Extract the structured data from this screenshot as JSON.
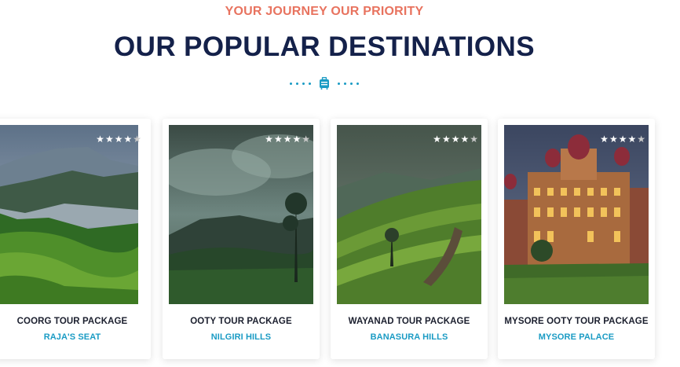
{
  "header": {
    "eyebrow": "YOUR JOURNEY OUR PRIORITY",
    "title": "OUR POPULAR DESTINATIONS",
    "divider_icon": "luggage-icon"
  },
  "colors": {
    "accent_orange": "#e8735f",
    "heading_navy": "#14214a",
    "accent_blue": "#1a9bc4"
  },
  "cards": [
    {
      "package": "COORG TOUR PACKAGE",
      "place": "RAJA'S SEAT",
      "rating": 4,
      "rating_max": 5
    },
    {
      "package": "OOTY TOUR PACKAGE",
      "place": "NILGIRI HILLS",
      "rating": 4,
      "rating_max": 5
    },
    {
      "package": "WAYANAD TOUR PACKAGE",
      "place": "BANASURA HILLS",
      "rating": 4,
      "rating_max": 5
    },
    {
      "package": "MYSORE OOTY TOUR PACKAGE",
      "place": "MYSORE PALACE",
      "rating": 4,
      "rating_max": 5
    }
  ]
}
